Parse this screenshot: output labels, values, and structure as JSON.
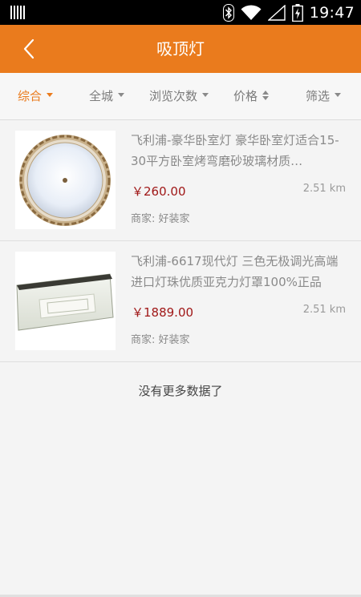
{
  "status_bar": {
    "time": "19:47",
    "icons": [
      "notification-bars-icon",
      "bluetooth-icon",
      "wifi-icon",
      "no-signal-icon",
      "battery-charging-icon"
    ]
  },
  "header": {
    "title": "吸顶灯",
    "back_icon": "chevron-left-icon",
    "background": "#ea7b1d"
  },
  "filters": [
    {
      "label": "综合",
      "active": true,
      "indicator": "caret-down"
    },
    {
      "label": "全城",
      "active": false,
      "indicator": "caret-down"
    },
    {
      "label": "浏览次数",
      "active": false,
      "indicator": "caret-down"
    },
    {
      "label": "价格",
      "active": false,
      "indicator": "sort"
    },
    {
      "label": "筛选",
      "active": false,
      "indicator": "caret-down"
    }
  ],
  "products": [
    {
      "title": "飞利浦-豪华卧室灯 豪华卧室灯适合15-30平方卧室烤弯磨砂玻璃材质…",
      "price": "￥260.00",
      "distance": "2.51 km",
      "merchant": "商家: 好装家"
    },
    {
      "title": "飞利浦-6617现代灯 三色无极调光高端进口灯珠优质亚克力灯罩100%正品",
      "price": "￥1889.00",
      "distance": "2.51 km",
      "merchant": "商家: 好装家"
    }
  ],
  "footer_text": "没有更多数据了",
  "colors": {
    "accent": "#ea7b1d",
    "price": "#a01818"
  }
}
